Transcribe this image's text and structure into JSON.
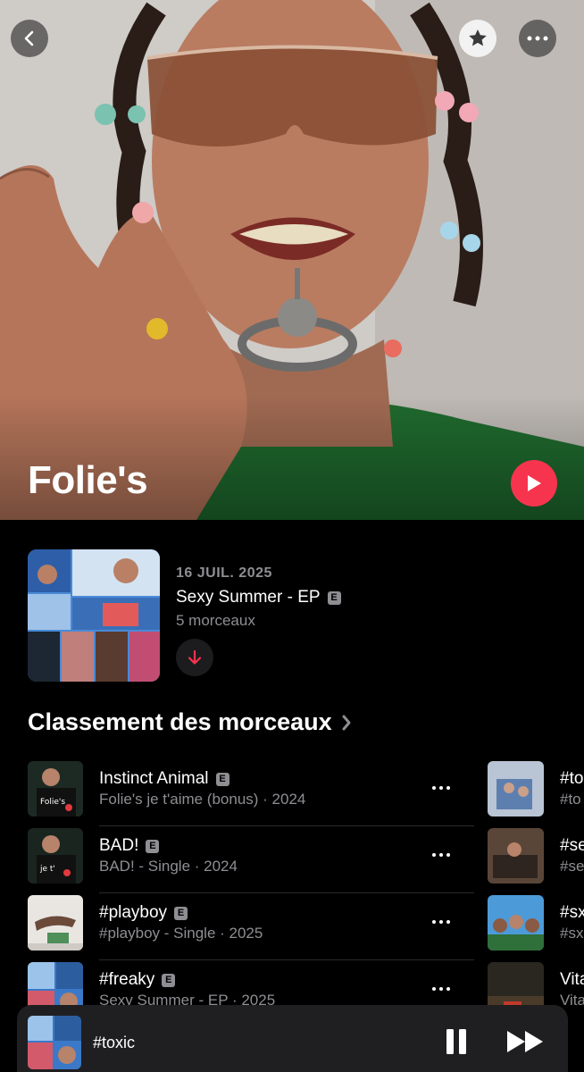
{
  "artist": {
    "name": "Folie's"
  },
  "top_bar": {
    "back_icon": "chevron-left-icon",
    "favorite_icon": "star-icon",
    "more_icon": "ellipsis-icon"
  },
  "latest_release": {
    "date": "16 JUIL. 2025",
    "title": "Sexy Summer - EP",
    "explicit": "E",
    "track_count": "5 morceaux",
    "download_icon": "download-arrow-icon"
  },
  "top_songs": {
    "title": "Classement des morceaux",
    "chevron": "›",
    "items": [
      {
        "title": "Instinct Animal",
        "explicit": "E",
        "subtitle": "Folie's je t'aime (bonus) · 2024",
        "art_color": "#1d2a24"
      },
      {
        "title": "BAD!",
        "explicit": "E",
        "subtitle": "BAD! - Single · 2024",
        "art_color": "#1a2520"
      },
      {
        "title": "#playboy",
        "explicit": "E",
        "subtitle": "#playboy - Single · 2025",
        "art_color": "#e9e6e2"
      },
      {
        "title": "#freaky",
        "explicit": "E",
        "subtitle": "Sexy Summer - EP · 2025",
        "art_color": "#3b78c8"
      }
    ],
    "column2": [
      {
        "title": "#to",
        "subtitle": "#to"
      },
      {
        "title": "#se",
        "subtitle": "#se"
      },
      {
        "title": "#sx",
        "subtitle": "#sx"
      },
      {
        "title": "Vita",
        "subtitle": "Vita"
      }
    ]
  },
  "mini_player": {
    "title": "#toxic",
    "pause_icon": "pause-icon",
    "next_icon": "fast-forward-icon"
  },
  "colors": {
    "accent": "#f7344e",
    "secondary_text": "#8e8e93",
    "background": "#000000"
  }
}
